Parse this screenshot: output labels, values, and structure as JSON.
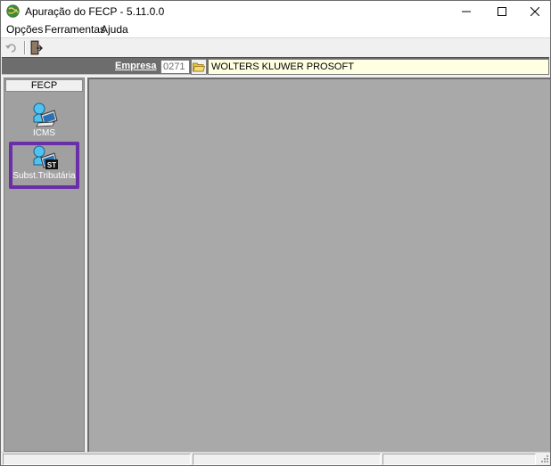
{
  "window": {
    "title": "Apuração do FECP - 5.11.0.0",
    "app_icon": "globe-icon",
    "controls": [
      "minimize-icon",
      "maximize-icon",
      "close-icon"
    ]
  },
  "menu": {
    "items": [
      {
        "label": "Opções"
      },
      {
        "label": "Ferramentas"
      },
      {
        "label": "Ajuda"
      }
    ]
  },
  "toolbar": {
    "buttons": [
      "undo-icon",
      "exit-door-icon"
    ]
  },
  "empresa": {
    "label": "Empresa",
    "code": "0271",
    "name": "WOLTERS KLUWER PROSOFT",
    "folder_icon": "open-folder-icon"
  },
  "sidebar": {
    "header": "FECP",
    "items": [
      {
        "label": "ICMS",
        "icon": "person-computer-icon",
        "selected": false
      },
      {
        "label": "Subst.Tributária",
        "icon": "person-computer-st-icon",
        "selected": true
      }
    ]
  },
  "statusbar": {
    "panels": [
      "",
      "",
      ""
    ]
  },
  "colors": {
    "highlight": "#6a2ea8",
    "empresa_bar": "#6d6d6d",
    "empresa_name_bg": "#ffffe1",
    "sidebar_bg": "#a0a0a0",
    "workspace_bg": "#a9a9a9"
  }
}
